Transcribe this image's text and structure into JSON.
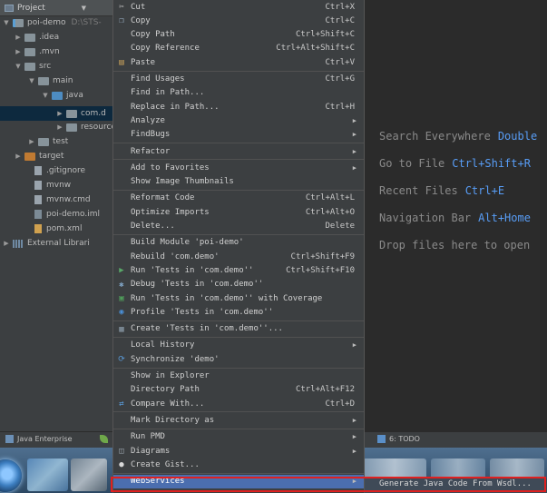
{
  "project": {
    "header": "Project",
    "tree": [
      {
        "label": "poi-demo",
        "path": "D:\\STS-",
        "arrow": "▼",
        "indent": 3,
        "kind": "module"
      },
      {
        "label": ".idea",
        "arrow": "▶",
        "indent": 16,
        "kind": "folder"
      },
      {
        "label": ".mvn",
        "arrow": "▶",
        "indent": 16,
        "kind": "folder"
      },
      {
        "label": "src",
        "arrow": "▼",
        "indent": 16,
        "kind": "folder"
      },
      {
        "label": "main",
        "arrow": "▼",
        "indent": 31,
        "kind": "folder"
      },
      {
        "label": "java",
        "arrow": "▼",
        "indent": 46,
        "kind": "blue"
      },
      {
        "label": "com.d",
        "arrow": "▶",
        "indent": 62,
        "kind": "package",
        "selected": true
      },
      {
        "label": "resource",
        "arrow": "▶",
        "indent": 62,
        "kind": "folder"
      },
      {
        "label": "test",
        "arrow": "▶",
        "indent": 31,
        "kind": "folder"
      },
      {
        "label": "target",
        "arrow": "▶",
        "indent": 16,
        "kind": "orange"
      },
      {
        "label": ".gitignore",
        "arrow": "",
        "indent": 27,
        "kind": "file"
      },
      {
        "label": "mvnw",
        "arrow": "",
        "indent": 27,
        "kind": "file"
      },
      {
        "label": "mvnw.cmd",
        "arrow": "",
        "indent": 27,
        "kind": "file"
      },
      {
        "label": "poi-demo.iml",
        "arrow": "",
        "indent": 27,
        "kind": "iml"
      },
      {
        "label": "pom.xml",
        "arrow": "",
        "indent": 27,
        "kind": "xml"
      },
      {
        "label": "External Librari",
        "arrow": "▶",
        "indent": 3,
        "kind": "libs"
      }
    ]
  },
  "menu": {
    "items": [
      {
        "label": "Cut",
        "shortcut": "Ctrl+X",
        "icon": "scissors-icon"
      },
      {
        "label": "Copy",
        "shortcut": "Ctrl+C",
        "icon": "copy-icon"
      },
      {
        "label": "Copy Path",
        "shortcut": "Ctrl+Shift+C"
      },
      {
        "label": "Copy Reference",
        "shortcut": "Ctrl+Alt+Shift+C"
      },
      {
        "label": "Paste",
        "shortcut": "Ctrl+V",
        "icon": "paste-icon"
      },
      {
        "sep": true
      },
      {
        "label": "Find Usages",
        "shortcut": "Ctrl+G"
      },
      {
        "label": "Find in Path...",
        "shortcut": ""
      },
      {
        "label": "Replace in Path...",
        "shortcut": "Ctrl+H"
      },
      {
        "label": "Analyze",
        "submenu": true
      },
      {
        "label": "FindBugs",
        "submenu": true
      },
      {
        "sep": true
      },
      {
        "label": "Refactor",
        "submenu": true
      },
      {
        "sep": true
      },
      {
        "label": "Add to Favorites",
        "submenu": true
      },
      {
        "label": "Show Image Thumbnails",
        "shortcut": ""
      },
      {
        "sep": true
      },
      {
        "label": "Reformat Code",
        "shortcut": "Ctrl+Alt+L"
      },
      {
        "label": "Optimize Imports",
        "shortcut": "Ctrl+Alt+O"
      },
      {
        "label": "Delete...",
        "shortcut": "Delete"
      },
      {
        "sep": true
      },
      {
        "label": "Build Module 'poi-demo'",
        "shortcut": ""
      },
      {
        "label": "Rebuild 'com.demo'",
        "shortcut": "Ctrl+Shift+F9"
      },
      {
        "label": "Run 'Tests in 'com.demo''",
        "shortcut": "Ctrl+Shift+F10",
        "icon": "run-icon"
      },
      {
        "label": "Debug 'Tests in 'com.demo''",
        "shortcut": "",
        "icon": "debug-icon"
      },
      {
        "label": "Run 'Tests in 'com.demo'' with Coverage",
        "shortcut": "",
        "icon": "coverage-icon"
      },
      {
        "label": "Profile 'Tests in 'com.demo''",
        "shortcut": "",
        "icon": "profile-icon"
      },
      {
        "sep": true
      },
      {
        "label": "Create 'Tests in 'com.demo''...",
        "shortcut": "",
        "icon": "create-config-icon"
      },
      {
        "sep": true
      },
      {
        "label": "Local History",
        "submenu": true
      },
      {
        "label": "Synchronize 'demo'",
        "shortcut": "",
        "icon": "sync-icon"
      },
      {
        "sep": true
      },
      {
        "label": "Show in Explorer",
        "shortcut": ""
      },
      {
        "label": "Directory Path",
        "shortcut": "Ctrl+Alt+F12"
      },
      {
        "label": "Compare With...",
        "shortcut": "Ctrl+D",
        "icon": "compare-icon"
      },
      {
        "sep": true
      },
      {
        "label": "Mark Directory as",
        "submenu": true
      },
      {
        "sep": true
      },
      {
        "label": "Run PMD",
        "submenu": true
      },
      {
        "label": "Diagrams",
        "submenu": true,
        "icon": "diagram-icon"
      },
      {
        "label": "Create Gist...",
        "shortcut": "",
        "icon": "github-icon"
      },
      {
        "sep": true
      },
      {
        "label": "WebServices",
        "submenu": true,
        "active": true
      }
    ]
  },
  "submenu": {
    "item": "Generate Java Code From Wsdl..."
  },
  "editor": {
    "hints": [
      {
        "text": "Search Everywhere",
        "key": "Double"
      },
      {
        "text": "Go to File",
        "key": "Ctrl+Shift+R"
      },
      {
        "text": "Recent Files",
        "key": "Ctrl+E"
      },
      {
        "text": "Navigation Bar",
        "key": "Alt+Home"
      },
      {
        "text": "Drop files here to open",
        "key": ""
      }
    ]
  },
  "bottom_bar": {
    "java_enterprise": "Java Enterprise",
    "todo": "6: TODO"
  },
  "colors": {
    "menu_bg": "#3c3f41",
    "menu_active": "#4b6eaf",
    "highlight_border": "#e02020",
    "shortcut_key": "#589df6"
  }
}
